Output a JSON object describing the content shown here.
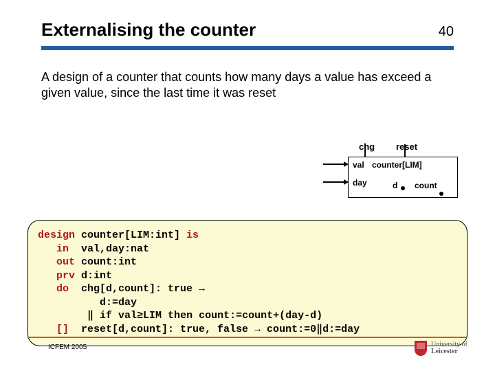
{
  "slide": {
    "title": "Externalising the counter",
    "number": "40",
    "description": "A design of a counter that counts how many days a value has exceed a given value, since the last time it was reset"
  },
  "diagram": {
    "top": {
      "chg": "chg",
      "reset": "reset"
    },
    "box": {
      "val": "val",
      "day": "day",
      "d": "d",
      "count": "count",
      "counter": "counter[LIM]"
    }
  },
  "code": {
    "l1a": "design",
    "l1b": " counter[LIM:int] ",
    "l1c": "is",
    "l2a": "   in ",
    "l2b": " val,day:nat",
    "l3a": "   out",
    "l3b": " count:int",
    "l4a": "   prv",
    "l4b": " d:int",
    "l5a": "   do ",
    "l5b": " chg[d,count]: true → ",
    "l6": "          d:=day",
    "l7": "        ‖ if val≥LIM then count:=count+(day-d)",
    "l8a": "   []  ",
    "l8b": "reset[d,count]: true, false → count:=0‖d:=day"
  },
  "footer": {
    "venue": "ICFEM 2005",
    "uni1": "University of",
    "uni2": "Leicester"
  }
}
